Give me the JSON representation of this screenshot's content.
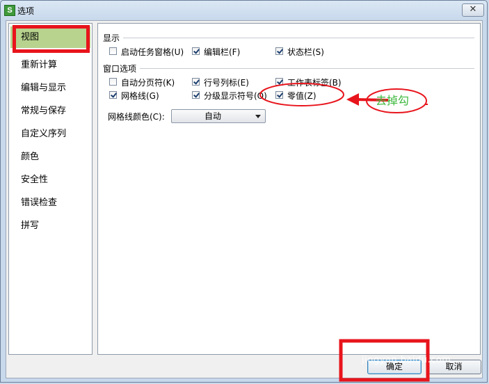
{
  "window": {
    "title": "选项",
    "app_icon_letter": "S",
    "close_glyph": "✕"
  },
  "sidebar": {
    "items": [
      {
        "label": "视图",
        "selected": true
      },
      {
        "label": "重新计算"
      },
      {
        "label": "编辑与显示"
      },
      {
        "label": "常规与保存"
      },
      {
        "label": "自定义序列"
      },
      {
        "label": "颜色"
      },
      {
        "label": "安全性"
      },
      {
        "label": "错误检查"
      },
      {
        "label": "拼写"
      }
    ]
  },
  "display_section": {
    "title": "显示",
    "options": [
      {
        "label": "启动任务窗格(U)",
        "checked": false
      },
      {
        "label": "编辑栏(F)",
        "checked": true
      },
      {
        "label": "状态栏(S)",
        "checked": true
      }
    ]
  },
  "window_options_section": {
    "title": "窗口选项",
    "options": [
      {
        "label": "自动分页符(K)",
        "checked": false
      },
      {
        "label": "行号列标(E)",
        "checked": true
      },
      {
        "label": "工作表标签(B)",
        "checked": true
      },
      {
        "label": "网格线(G)",
        "checked": true
      },
      {
        "label": "分级显示符号(O)",
        "checked": true
      },
      {
        "label": "零值(Z)",
        "checked": true
      }
    ]
  },
  "gridline_color": {
    "label": "网格线颜色(C):",
    "value": "自动"
  },
  "buttons": {
    "ok": "确定",
    "cancel": "取消"
  },
  "annotation": {
    "text": "去掉勾",
    "color": "#e8141c",
    "text_color": "#3db83d"
  },
  "watermark": "jingyan.baidu.com"
}
